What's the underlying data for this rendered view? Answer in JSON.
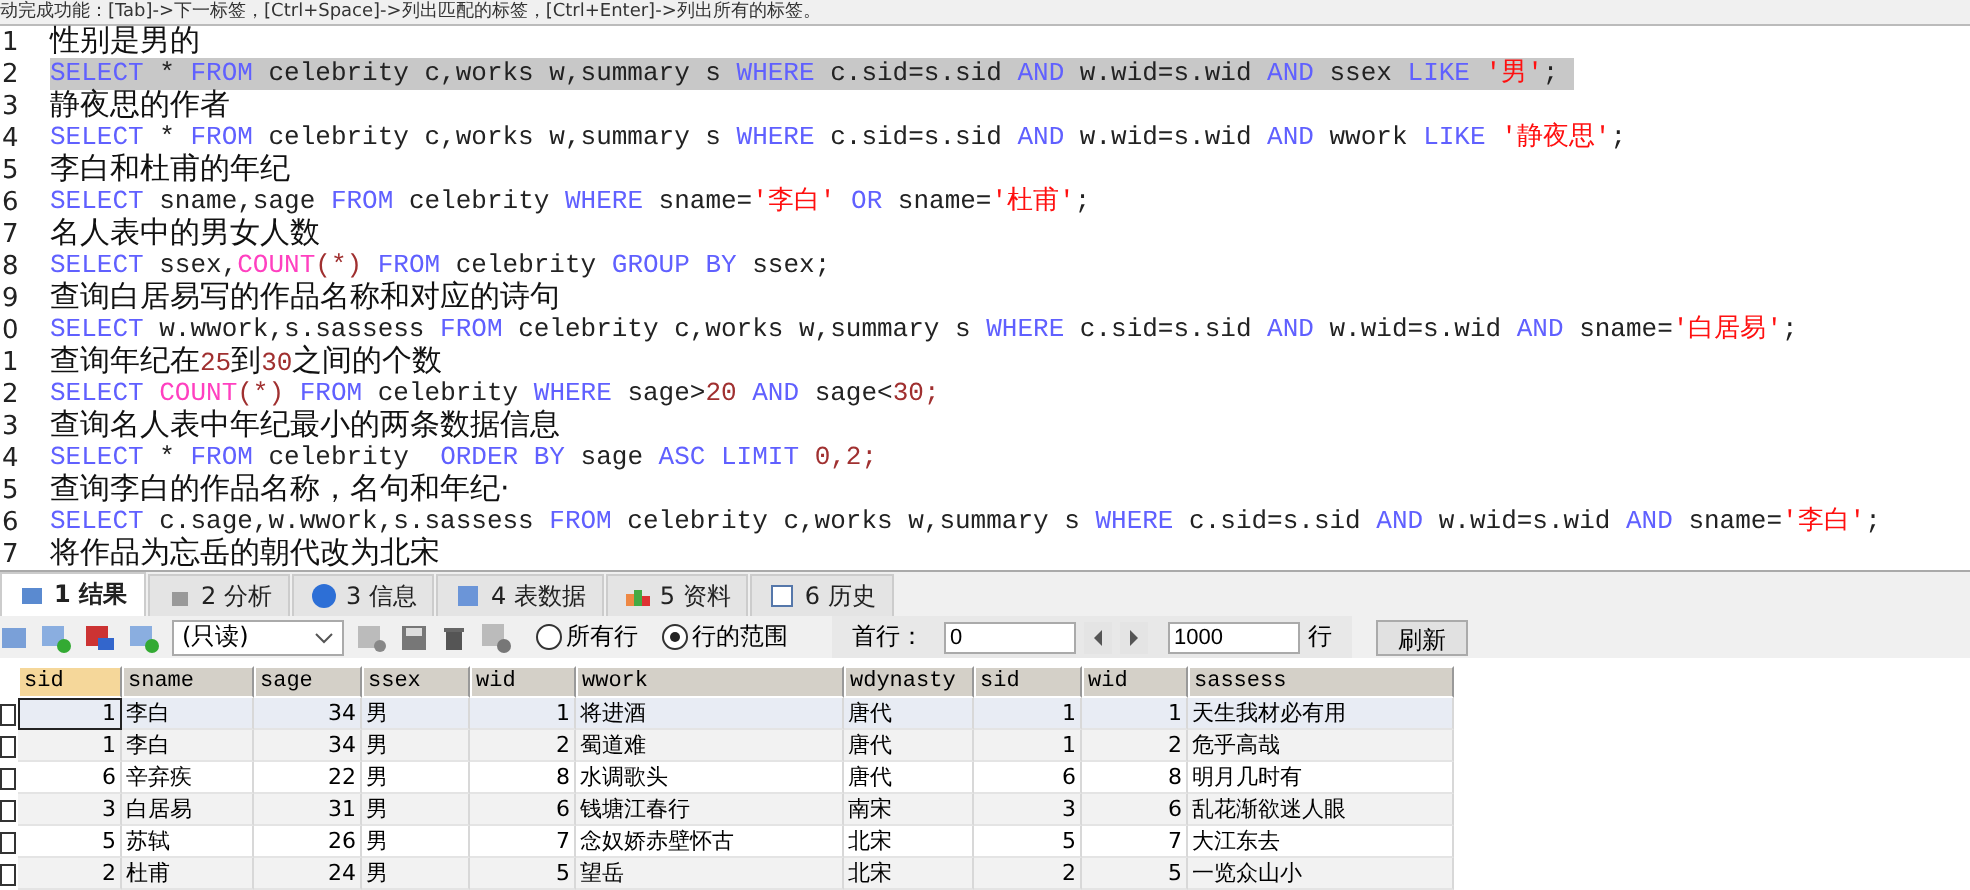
{
  "hint_bar": "动完成功能：[Tab]->下一标签，[Ctrl+Space]->列出匹配的标签，[Ctrl+Enter]->列出所有的标签。",
  "editor": {
    "lines": [
      {
        "num": "1",
        "selected": false,
        "segments": [
          {
            "kind": "text",
            "text": "性别是男的"
          }
        ]
      },
      {
        "num": "2",
        "selected": true,
        "segments": [
          {
            "kind": "keyword",
            "text": "SELECT"
          },
          {
            "kind": "plain",
            "text": " * "
          },
          {
            "kind": "keyword",
            "text": "FROM"
          },
          {
            "kind": "plain",
            "text": " celebrity c,works w,summary s "
          },
          {
            "kind": "keyword",
            "text": "WHERE"
          },
          {
            "kind": "plain",
            "text": " c.sid=s.sid "
          },
          {
            "kind": "keyword",
            "text": "AND"
          },
          {
            "kind": "plain",
            "text": " w.wid=s.wid "
          },
          {
            "kind": "keyword",
            "text": "AND"
          },
          {
            "kind": "plain",
            "text": " ssex "
          },
          {
            "kind": "keyword",
            "text": "LIKE "
          },
          {
            "kind": "string",
            "text": "'男'"
          },
          {
            "kind": "plain",
            "text": ";"
          }
        ]
      },
      {
        "num": "3",
        "selected": false,
        "segments": [
          {
            "kind": "text",
            "text": "静夜思的作者"
          }
        ]
      },
      {
        "num": "4",
        "selected": false,
        "segments": [
          {
            "kind": "keyword",
            "text": "SELECT"
          },
          {
            "kind": "plain",
            "text": " * "
          },
          {
            "kind": "keyword",
            "text": "FROM"
          },
          {
            "kind": "plain",
            "text": " celebrity c,works w,summary s "
          },
          {
            "kind": "keyword",
            "text": "WHERE"
          },
          {
            "kind": "plain",
            "text": " c.sid=s.sid "
          },
          {
            "kind": "keyword",
            "text": "AND"
          },
          {
            "kind": "plain",
            "text": " w.wid=s.wid "
          },
          {
            "kind": "keyword",
            "text": "AND"
          },
          {
            "kind": "plain",
            "text": " wwork "
          },
          {
            "kind": "keyword",
            "text": "LIKE "
          },
          {
            "kind": "string",
            "text": "'静夜思'"
          },
          {
            "kind": "plain",
            "text": ";"
          }
        ]
      },
      {
        "num": "5",
        "selected": false,
        "segments": [
          {
            "kind": "text",
            "text": "李白和杜甫的年纪"
          }
        ]
      },
      {
        "num": "6",
        "selected": false,
        "segments": [
          {
            "kind": "keyword",
            "text": "SELECT"
          },
          {
            "kind": "plain",
            "text": " sname,sage "
          },
          {
            "kind": "keyword",
            "text": "FROM"
          },
          {
            "kind": "plain",
            "text": " celebrity "
          },
          {
            "kind": "keyword",
            "text": "WHERE"
          },
          {
            "kind": "plain",
            "text": " sname="
          },
          {
            "kind": "string",
            "text": "'李白' "
          },
          {
            "kind": "keyword",
            "text": "OR"
          },
          {
            "kind": "plain",
            "text": " sname="
          },
          {
            "kind": "string",
            "text": "'杜甫'"
          },
          {
            "kind": "plain",
            "text": ";"
          }
        ]
      },
      {
        "num": "7",
        "selected": false,
        "segments": [
          {
            "kind": "text",
            "text": "名人表中的男女人数"
          }
        ]
      },
      {
        "num": "8",
        "selected": false,
        "segments": [
          {
            "kind": "keyword",
            "text": "SELECT"
          },
          {
            "kind": "plain",
            "text": " ssex,"
          },
          {
            "kind": "function",
            "text": "COUNT"
          },
          {
            "kind": "number",
            "text": "(*) "
          },
          {
            "kind": "keyword",
            "text": "FROM"
          },
          {
            "kind": "plain",
            "text": " celebrity "
          },
          {
            "kind": "keyword",
            "text": "GROUP BY"
          },
          {
            "kind": "plain",
            "text": " ssex;"
          }
        ]
      },
      {
        "num": "9",
        "selected": false,
        "segments": [
          {
            "kind": "text",
            "text": "查询白居易写的作品名称和对应的诗句"
          }
        ]
      },
      {
        "num": "0",
        "selected": false,
        "segments": [
          {
            "kind": "keyword",
            "text": "SELECT"
          },
          {
            "kind": "plain",
            "text": " w.wwork,s.sassess "
          },
          {
            "kind": "keyword",
            "text": "FROM"
          },
          {
            "kind": "plain",
            "text": " celebrity c,works w,summary s "
          },
          {
            "kind": "keyword",
            "text": "WHERE"
          },
          {
            "kind": "plain",
            "text": " c.sid=s.sid "
          },
          {
            "kind": "keyword",
            "text": "AND"
          },
          {
            "kind": "plain",
            "text": " w.wid=s.wid "
          },
          {
            "kind": "keyword",
            "text": "AND"
          },
          {
            "kind": "plain",
            "text": " sname="
          },
          {
            "kind": "string",
            "text": "'白居易'"
          },
          {
            "kind": "plain",
            "text": ";"
          }
        ]
      },
      {
        "num": "1",
        "selected": false,
        "segments": [
          {
            "kind": "text",
            "text": "查询年纪在"
          },
          {
            "kind": "number",
            "text": "25"
          },
          {
            "kind": "text",
            "text": "到"
          },
          {
            "kind": "number",
            "text": "30"
          },
          {
            "kind": "text",
            "text": "之间的个数"
          }
        ]
      },
      {
        "num": "2",
        "selected": false,
        "segments": [
          {
            "kind": "keyword",
            "text": "SELECT "
          },
          {
            "kind": "function",
            "text": "COUNT"
          },
          {
            "kind": "number",
            "text": "(*) "
          },
          {
            "kind": "keyword",
            "text": "FROM"
          },
          {
            "kind": "plain",
            "text": " celebrity "
          },
          {
            "kind": "keyword",
            "text": "WHERE"
          },
          {
            "kind": "plain",
            "text": " sage>"
          },
          {
            "kind": "number",
            "text": "20 "
          },
          {
            "kind": "keyword",
            "text": "AND"
          },
          {
            "kind": "plain",
            "text": " sage<"
          },
          {
            "kind": "number",
            "text": "30;"
          }
        ]
      },
      {
        "num": "3",
        "selected": false,
        "segments": [
          {
            "kind": "text",
            "text": "查询名人表中年纪最小的两条数据信息"
          }
        ]
      },
      {
        "num": "4",
        "selected": false,
        "segments": [
          {
            "kind": "keyword",
            "text": "SELECT"
          },
          {
            "kind": "plain",
            "text": " * "
          },
          {
            "kind": "keyword",
            "text": "FROM"
          },
          {
            "kind": "plain",
            "text": " celebrity  "
          },
          {
            "kind": "keyword",
            "text": "ORDER BY"
          },
          {
            "kind": "plain",
            "text": " sage "
          },
          {
            "kind": "keyword",
            "text": "ASC LIMIT "
          },
          {
            "kind": "number",
            "text": "0,2;"
          }
        ]
      },
      {
        "num": "5",
        "selected": false,
        "segments": [
          {
            "kind": "text",
            "text": "查询李白的作品名称，名句和年纪·"
          }
        ]
      },
      {
        "num": "6",
        "selected": false,
        "segments": [
          {
            "kind": "keyword",
            "text": "SELECT"
          },
          {
            "kind": "plain",
            "text": " c.sage,w.wwork,s.sassess "
          },
          {
            "kind": "keyword",
            "text": "FROM"
          },
          {
            "kind": "plain",
            "text": " celebrity c,works w,summary s "
          },
          {
            "kind": "keyword",
            "text": "WHERE"
          },
          {
            "kind": "plain",
            "text": " c.sid=s.sid "
          },
          {
            "kind": "keyword",
            "text": "AND"
          },
          {
            "kind": "plain",
            "text": " w.wid=s.wid "
          },
          {
            "kind": "keyword",
            "text": "AND"
          },
          {
            "kind": "plain",
            "text": " sname="
          },
          {
            "kind": "string",
            "text": "'李白'"
          },
          {
            "kind": "plain",
            "text": ";"
          }
        ]
      },
      {
        "num": "7",
        "selected": false,
        "segments": [
          {
            "kind": "text",
            "text": "将作品为忘岳的朝代改为北宋"
          }
        ]
      }
    ]
  },
  "tabs": [
    {
      "label": "1 结果",
      "selected": true
    },
    {
      "label": "2 分析",
      "selected": false
    },
    {
      "label": "3 信息",
      "selected": false
    },
    {
      "label": "4 表数据",
      "selected": false
    },
    {
      "label": "5 资料",
      "selected": false
    },
    {
      "label": "6 历史",
      "selected": false
    }
  ],
  "toolbar": {
    "mode_select": "(只读)",
    "radios": [
      {
        "label": "所有行",
        "selected": false
      },
      {
        "label": "行的范围",
        "selected": true
      }
    ],
    "first_row_label": "首行：",
    "first_row_value": "0",
    "row_count_value": "1000",
    "row_count_label": "行",
    "refresh_button": "刷新"
  },
  "table": {
    "columns": [
      "sid",
      "sname",
      "sage",
      "ssex",
      "wid",
      "wwork",
      "wdynasty",
      "sid",
      "wid",
      "sassess"
    ],
    "rows": [
      [
        "1",
        "李白",
        "34",
        "男",
        "1",
        "将进酒",
        "唐代",
        "1",
        "1",
        "天生我材必有用"
      ],
      [
        "1",
        "李白",
        "34",
        "男",
        "2",
        "蜀道难",
        "唐代",
        "1",
        "2",
        "危乎高哉"
      ],
      [
        "6",
        "辛弃疾",
        "22",
        "男",
        "8",
        "水调歌头",
        "唐代",
        "6",
        "8",
        "明月几时有"
      ],
      [
        "3",
        "白居易",
        "31",
        "男",
        "6",
        "钱塘江春行",
        "南宋",
        "3",
        "6",
        "乱花渐欲迷人眼"
      ],
      [
        "5",
        "苏轼",
        "26",
        "男",
        "7",
        "念奴娇赤壁怀古",
        "北宋",
        "5",
        "7",
        "大江东去"
      ],
      [
        "2",
        "杜甫",
        "24",
        "男",
        "5",
        "望岳",
        "北宋",
        "2",
        "5",
        "一览众山小"
      ]
    ]
  }
}
